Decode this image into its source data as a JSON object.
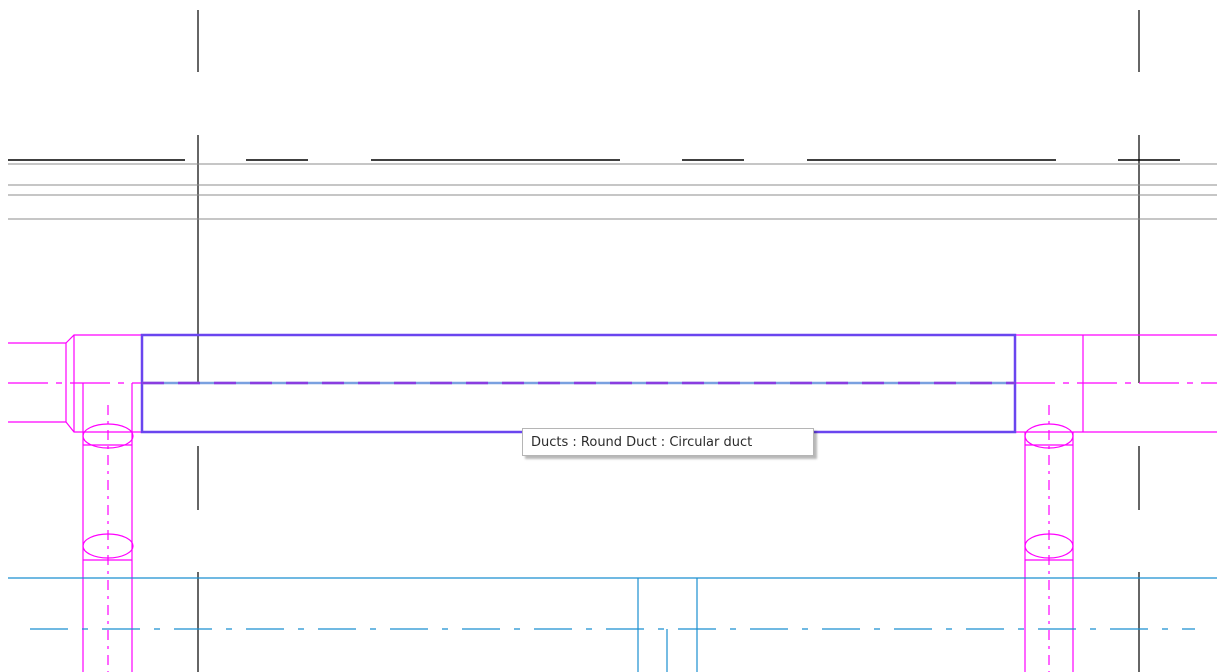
{
  "drawing": {
    "tooltip_text": "Ducts : Round Duct : Circular duct",
    "colors": {
      "grid_line": "#000000",
      "wall_line": "#808080",
      "duct_fitting": "#ff00ff",
      "selected_duct": "#6a45ef",
      "selected_centerline": "#7aa0e0",
      "pipe": "#1a8fd0"
    }
  }
}
